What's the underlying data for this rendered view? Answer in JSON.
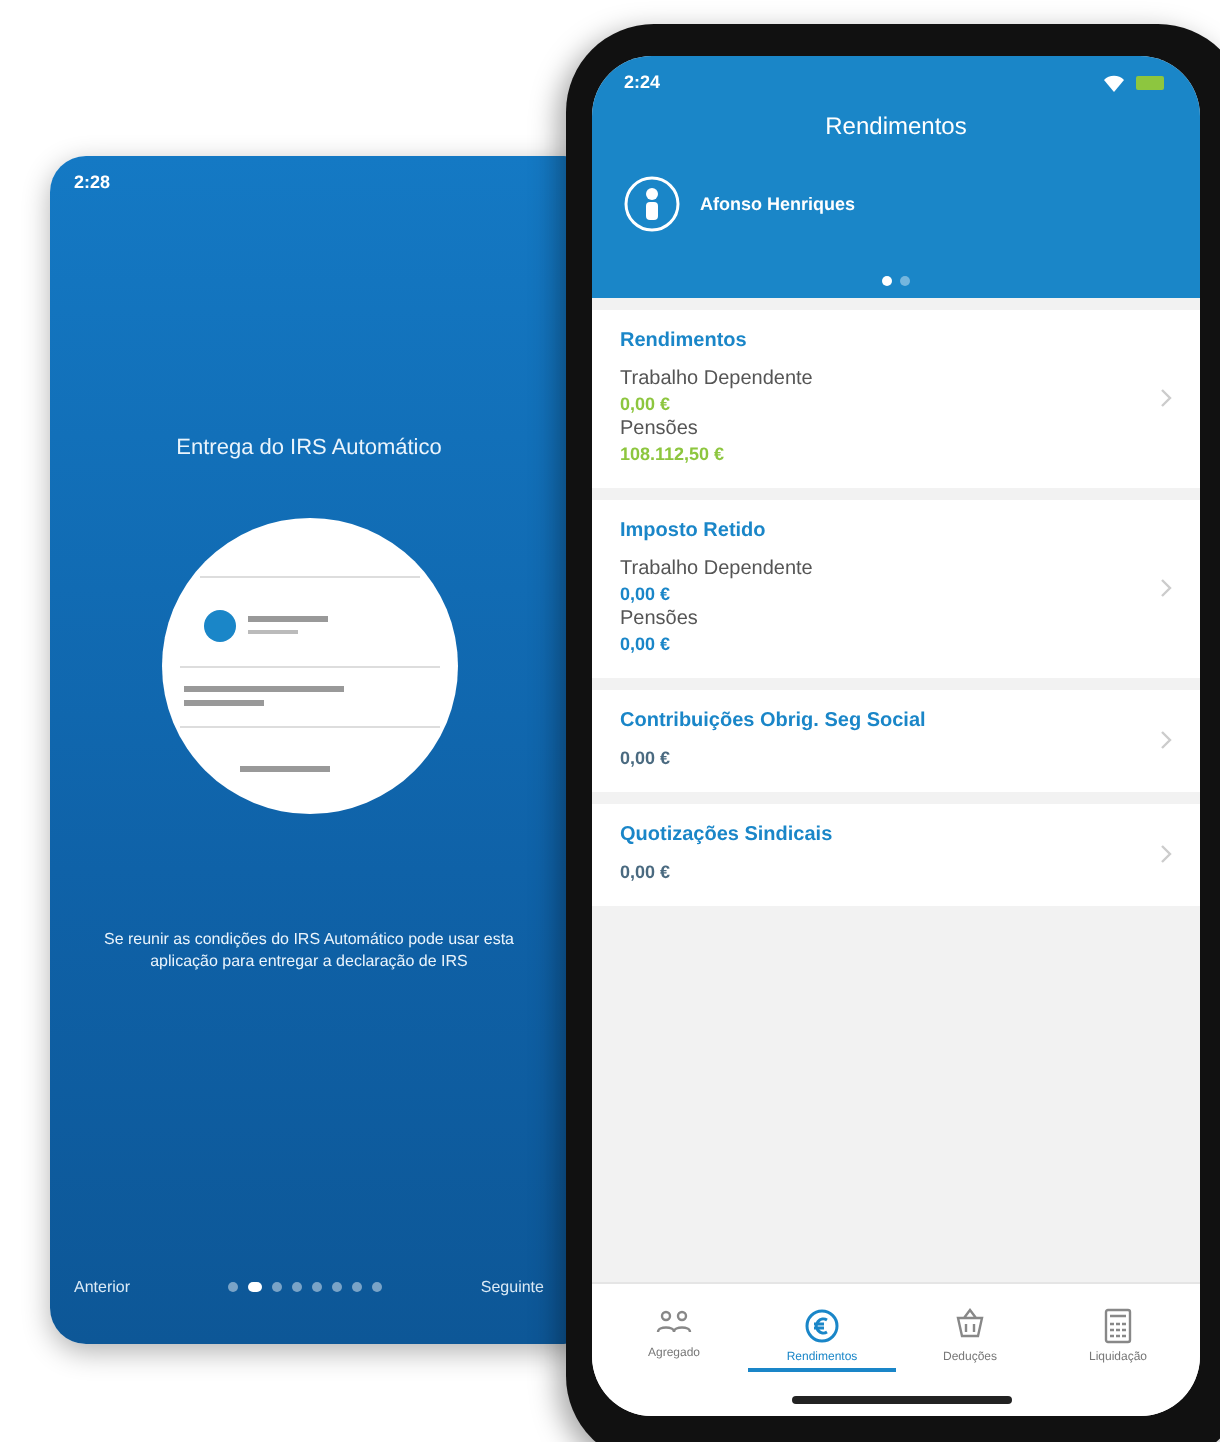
{
  "back_screen": {
    "status_time": "2:28",
    "title": "Entrega do IRS Automático",
    "description": "Se reunir as condições do IRS Automático pode usar esta aplicação para entregar a declaração de IRS",
    "back_link": "Anterior",
    "next_link": "Seguinte",
    "page_dots": [
      {
        "selected": false
      },
      {
        "selected": true
      },
      {
        "selected": false
      },
      {
        "selected": false
      },
      {
        "selected": false
      },
      {
        "selected": false
      },
      {
        "selected": false
      },
      {
        "selected": false
      }
    ]
  },
  "front_screen": {
    "status_time": "2:24",
    "title": "Rendimentos",
    "profile": {
      "name": "Afonso Henriques"
    },
    "header_dots": [
      {
        "selected": true
      },
      {
        "selected": false
      }
    ],
    "cards": [
      {
        "title": "Rendimentos",
        "entries": [
          {
            "label": "Trabalho Dependente",
            "value": "0,00 €",
            "color": "#8dc63f"
          },
          {
            "label": "Pensões",
            "value": "108.112,50 €",
            "color": "#8dc63f"
          }
        ]
      },
      {
        "title": "Imposto Retido",
        "entries": [
          {
            "label": "Trabalho Dependente",
            "value": "0,00 €",
            "color": "#1a86c8"
          },
          {
            "label": "Pensões",
            "value": "0,00 €",
            "color": "#1a86c8"
          }
        ]
      },
      {
        "title": "Contribuições Obrig. Seg Social",
        "entries": [
          {
            "value": "0,00 €",
            "color": "#4a6a80"
          }
        ]
      },
      {
        "title": "Quotizações Sindicais",
        "entries": [
          {
            "value": "0,00 €",
            "color": "#4a6a80"
          }
        ]
      }
    ],
    "tabs": [
      {
        "label": "Agregado",
        "kind": "people",
        "selected": false
      },
      {
        "label": "Rendimentos",
        "kind": "euro",
        "selected": true
      },
      {
        "label": "Deduções",
        "kind": "basket",
        "selected": false
      },
      {
        "label": "Liquidação",
        "kind": "calculator",
        "selected": false
      }
    ]
  }
}
